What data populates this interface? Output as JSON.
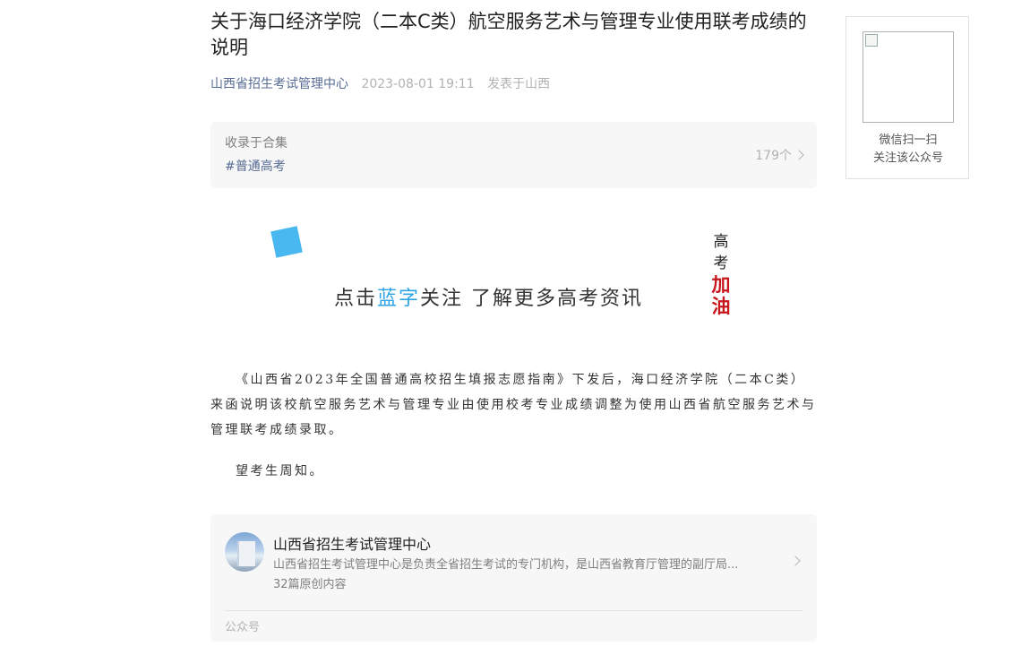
{
  "article": {
    "title": "关于海口经济学院（二本C类）航空服务艺术与管理专业使用联考成绩的说明",
    "author": "山西省招生考试管理中心",
    "date": "2023-08-01 19:11",
    "location": "发表于山西"
  },
  "collection": {
    "label": "收录于合集",
    "tag": "#普通高考",
    "count": "179个"
  },
  "banner": {
    "slogan_pre": "点击",
    "slogan_blue": "蓝字",
    "slogan_post": "关注 了解更多高考资讯",
    "vertical": [
      "高",
      "考",
      "加",
      "油"
    ],
    "accent_color": "#2fa4e7",
    "red_color": "#c8161d"
  },
  "content": {
    "paragraph1": "《山西省2023年全国普通高校招生填报志愿指南》下发后，海口经济学院（二本C类）来函说明该校航空服务艺术与管理专业由使用校考专业成绩调整为使用山西省航空服务艺术与管理联考成绩录取。",
    "paragraph2": "望考生周知。"
  },
  "account_card": {
    "name": "山西省招生考试管理中心",
    "description": "山西省招生考试管理中心是负责全省招生考试的专门机构，是山西省教育厅管理的副厅局...",
    "posts": "32篇原创内容",
    "type": "公众号"
  },
  "qr_panel": {
    "line1": "微信扫一扫",
    "line2": "关注该公众号"
  }
}
